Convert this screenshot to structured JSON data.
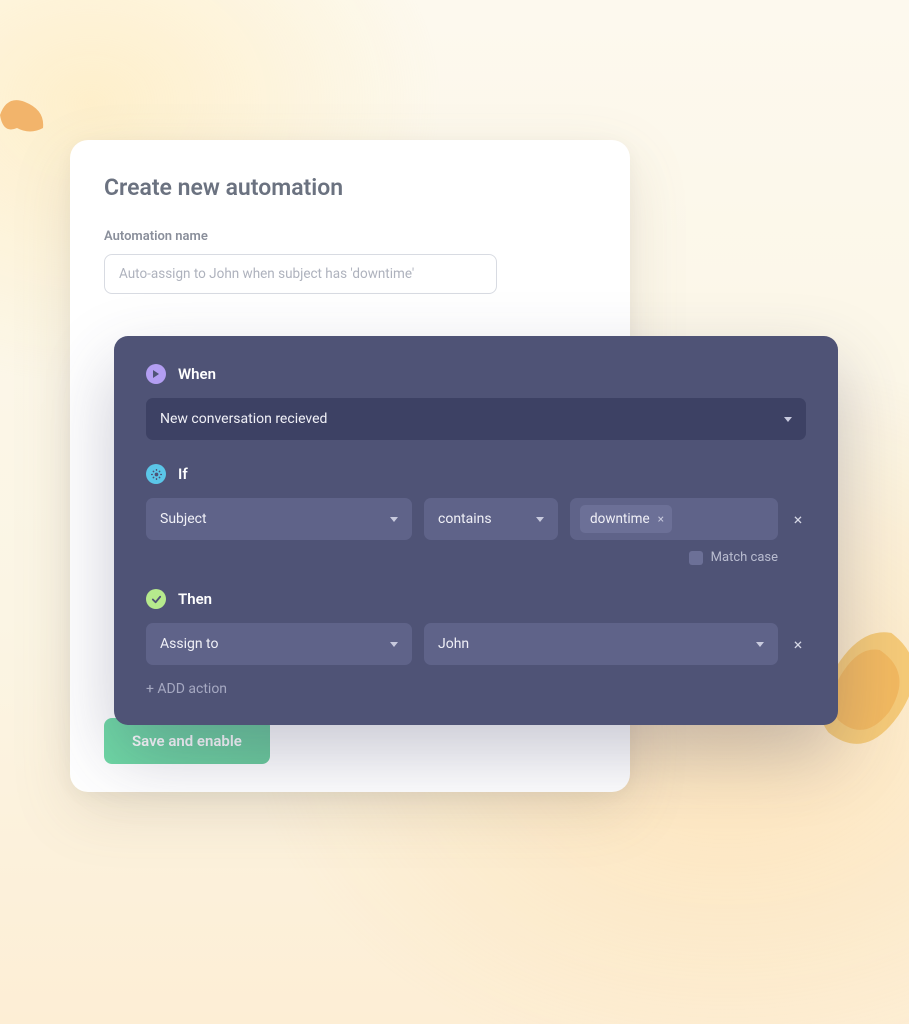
{
  "page": {
    "title": "Create new automation"
  },
  "name_field": {
    "label": "Automation name",
    "placeholder": "Auto-assign to John when subject has 'downtime'"
  },
  "sections": {
    "when": {
      "label": "When",
      "icon": "play-icon",
      "icon_color": "#b39ef2"
    },
    "if": {
      "label": "If",
      "icon": "gear-icon",
      "icon_color": "#5bc6e8"
    },
    "then": {
      "label": "Then",
      "icon": "check-icon",
      "icon_color": "#b6ea8d"
    }
  },
  "when": {
    "trigger": "New conversation recieved"
  },
  "if": {
    "field": "Subject",
    "operator": "contains",
    "values": [
      "downtime"
    ],
    "match_case_label": "Match case",
    "match_case_checked": false
  },
  "then": {
    "action": "Assign to",
    "target": "John",
    "add_action_label": "+ ADD action"
  },
  "buttons": {
    "save": "Save and enable"
  }
}
